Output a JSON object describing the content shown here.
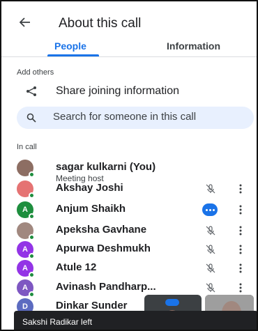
{
  "header": {
    "title": "About this call"
  },
  "tabs": [
    {
      "label": "People",
      "active": true
    },
    {
      "label": "Information",
      "active": false
    }
  ],
  "add_others": {
    "section_label": "Add others",
    "share_label": "Share joining information"
  },
  "search": {
    "placeholder": "Search for someone in this call"
  },
  "in_call": {
    "section_label": "In call",
    "people": [
      {
        "name": "sagar kulkarni (You)",
        "subtitle": "Meeting host",
        "avatar_color": "#8d6e63",
        "initial": "",
        "status": "none"
      },
      {
        "name": "Akshay Joshi",
        "avatar_color": "#e57373",
        "initial": "",
        "status": "muted"
      },
      {
        "name": "Anjum Shaikh",
        "avatar_color": "#1e8e3e",
        "initial": "A",
        "status": "speaking"
      },
      {
        "name": "Apeksha Gavhane",
        "avatar_color": "#a1887f",
        "initial": "",
        "status": "muted"
      },
      {
        "name": "Apurwa Deshmukh",
        "avatar_color": "#9334e6",
        "initial": "A",
        "status": "muted"
      },
      {
        "name": "Atule 12",
        "avatar_color": "#9334e6",
        "initial": "A",
        "status": "muted"
      },
      {
        "name": "Avinash Pandharp...",
        "avatar_color": "#7e57c2",
        "initial": "A",
        "status": "muted"
      },
      {
        "name": "Dinkar Sunder",
        "avatar_color": "#5c6bc0",
        "initial": "D",
        "status": "none"
      }
    ]
  },
  "toast": {
    "text": "Sakshi Radikar left"
  },
  "colors": {
    "accent": "#1a73e8",
    "online": "#1e8e3e",
    "search_bg": "#e8f0fe"
  },
  "icons": [
    "back-arrow-icon",
    "share-icon",
    "search-icon",
    "mic-off-icon",
    "more-vert-icon",
    "speaking-icon"
  ]
}
